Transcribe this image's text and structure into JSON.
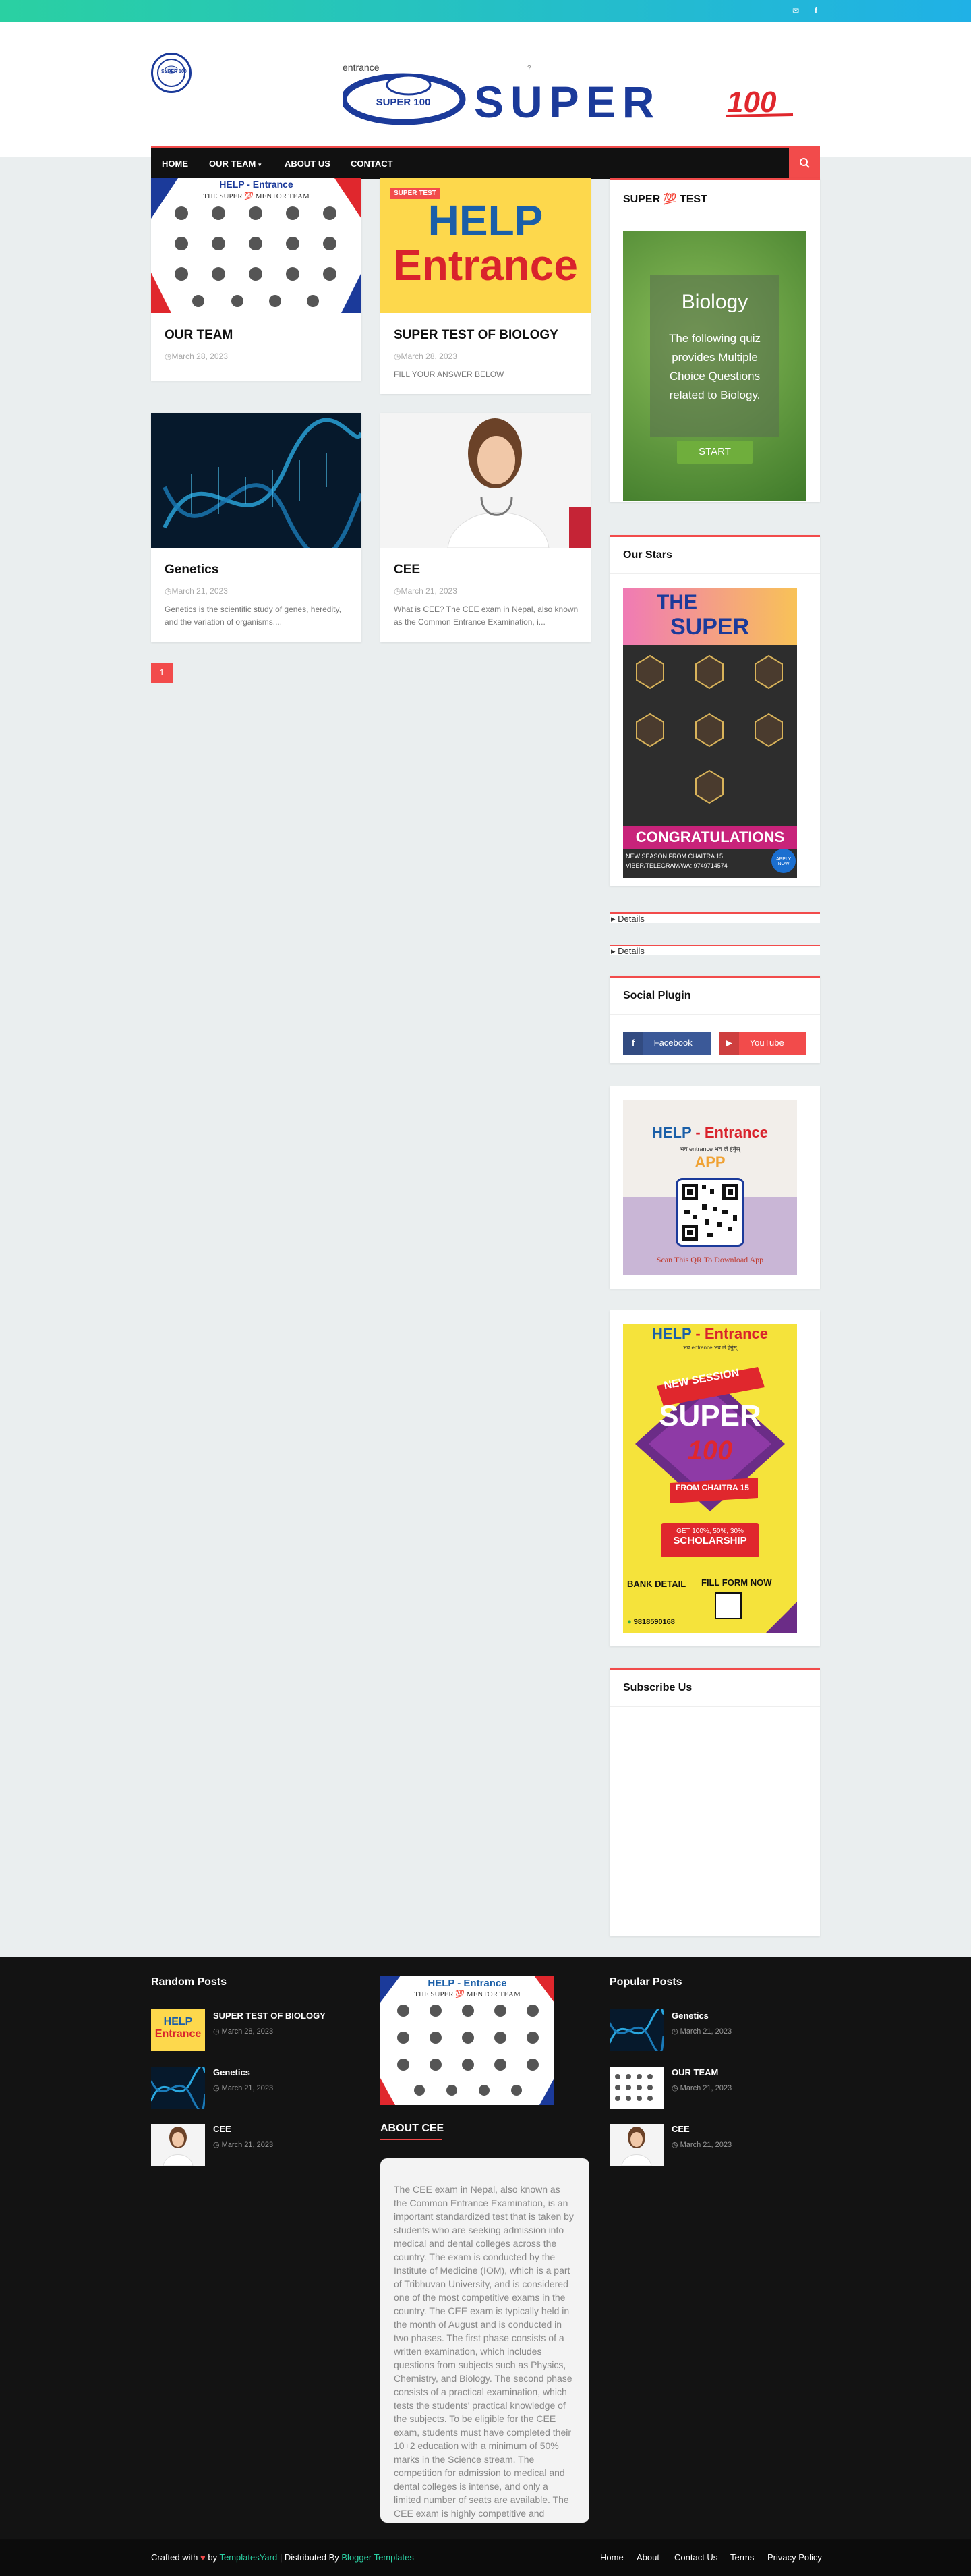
{
  "topbar": {
    "mail_icon": "mail-icon",
    "facebook_icon": "facebook-icon"
  },
  "header": {
    "logo_text": "SUPER 100",
    "banner_alt": "entrance",
    "banner_q": "?",
    "banner_text": "SUPER",
    "banner_num": "100"
  },
  "nav": {
    "items": [
      "HOME",
      "OUR TEAM",
      "ABOUT US",
      "CONTACT"
    ],
    "search_icon": "search-icon"
  },
  "posts": [
    {
      "title": "OUR TEAM",
      "date": "March 28, 2023",
      "snippet": "",
      "thumb_text": "HELP - Entrance",
      "thumb_sub": "THE SUPER 💯 MENTOR TEAM"
    },
    {
      "title": "SUPER TEST OF BIOLOGY",
      "date": "March 28, 2023",
      "snippet": "FILL YOUR ANSWER BELOW",
      "tag": "SUPER TEST",
      "thumb_l1": "HELP",
      "thumb_l2": "Entrance"
    },
    {
      "title": "Genetics",
      "date": "March 21, 2023",
      "snippet": "Genetics is the scientific study of genes, heredity, and the variation of organisms...."
    },
    {
      "title": "CEE",
      "date": "March 21, 2023",
      "snippet": "What is CEE? The CEE exam in Nepal, also known as the Common Entrance Examination, i..."
    }
  ],
  "pagination": {
    "current": "1"
  },
  "sidebar": {
    "test_title": "SUPER 💯 TEST",
    "quiz": {
      "heading": "Biology",
      "text": "The following quiz provides Multiple Choice Questions related to Biology.",
      "button": "START"
    },
    "stars_title": "Our Stars",
    "stars": {
      "header_the": "THE",
      "header_super": "SUPER",
      "congrats": "CONGRATULATIONS",
      "footer1": "NEW SEASON FROM CHAITRA 15",
      "footer2": "VIBER/TELEGRAM/WA: 9749714574",
      "apply": "APPLY NOW"
    },
    "details": [
      "Details",
      "Details"
    ],
    "social_title": "Social Plugin",
    "social": [
      {
        "label": "Facebook",
        "icon": "facebook-icon"
      },
      {
        "label": "YouTube",
        "icon": "youtube-icon"
      }
    ],
    "app": {
      "title_help": "HELP",
      "title_entrance": "- Entrance",
      "subtitle": "भव entrance भव ले हेर्नुस्",
      "app": "APP",
      "scan": "Scan This QR To Download App"
    },
    "poster": {
      "title_help": "HELP",
      "title_entrance": "- Entrance",
      "subtitle": "भव entrance भव ले हेर्नुस्",
      "new_session": "NEW SESSION",
      "super": "SUPER",
      "num": "100",
      "from": "FROM CHAITRA 15",
      "scholarship_top": "GET 100%, 50%, 30%",
      "scholarship": "SCHOLARSHIP",
      "bank": "BANK DETAIL",
      "fill": "FILL FORM NOW",
      "phone": "9818590168"
    },
    "subscribe_title": "Subscribe Us"
  },
  "footer": {
    "random_title": "Random Posts",
    "random": [
      {
        "title": "SUPER TEST OF BIOLOGY",
        "date": "March 28, 2023"
      },
      {
        "title": "Genetics",
        "date": "March 21, 2023"
      },
      {
        "title": "CEE",
        "date": "March 21, 2023"
      }
    ],
    "about_title": "ABOUT CEE",
    "about_text": "The CEE exam in Nepal, also known as the Common Entrance Examination, is an important standardized test that is taken by students who are seeking admission into medical and dental colleges across the country. The exam is conducted by the Institute of Medicine (IOM), which is a part of Tribhuvan University, and is considered one of the most competitive exams in the country. The CEE exam is typically held in the month of August and is conducted in two phases. The first phase consists of a written examination, which includes questions from subjects such as Physics, Chemistry, and Biology. The second phase consists of a practical examination, which tests the students' practical knowledge of the subjects. To be eligible for the CEE exam, students must have completed their 10+2 education with a minimum of 50% marks in the Science stream. The competition for admission to medical and dental colleges is intense, and only a limited number of seats are available. The CEE exam is highly competitive and requires a lot of preparation.",
    "popular_title": "Popular Posts",
    "popular": [
      {
        "title": "Genetics",
        "date": "March 21, 2023"
      },
      {
        "title": "OUR TEAM",
        "date": "March 21, 2023"
      },
      {
        "title": "CEE",
        "date": "March 21, 2023"
      }
    ],
    "team_img_title": "HELP - Entrance",
    "team_img_sub": "THE SUPER 💯 MENTOR TEAM"
  },
  "bottombar": {
    "crafted": "Crafted with",
    "by": "by",
    "templatesyard": "TemplatesYard",
    "distributed": "| Distributed By",
    "blogger": "Blogger Templates",
    "links": [
      "Home",
      "About",
      "Contact Us",
      "Terms",
      "Privacy Policy"
    ]
  },
  "colors": {
    "accent": "#f24b4b",
    "teal": "#2ad0a2",
    "blue": "#20b1e6"
  }
}
